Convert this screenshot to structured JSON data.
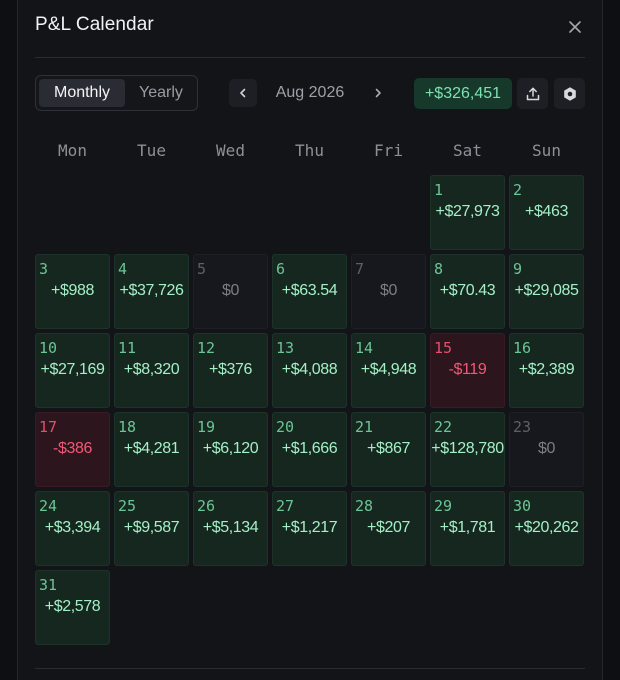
{
  "header": {
    "title": "P&L Calendar"
  },
  "toolbar": {
    "views": [
      "Monthly",
      "Yearly"
    ],
    "active_view": "Monthly",
    "month_label": "Aug 2026",
    "total": "+$326,451"
  },
  "weekdays": [
    "Mon",
    "Tue",
    "Wed",
    "Thu",
    "Fri",
    "Sat",
    "Sun"
  ],
  "calendar": {
    "first_day_column": 5,
    "days": [
      {
        "day": "1",
        "value": "+$27,973",
        "status": "pos"
      },
      {
        "day": "2",
        "value": "+$463",
        "status": "pos"
      },
      {
        "day": "3",
        "value": "+$988",
        "status": "pos"
      },
      {
        "day": "4",
        "value": "+$37,726",
        "status": "pos"
      },
      {
        "day": "5",
        "value": "$0",
        "status": "zero"
      },
      {
        "day": "6",
        "value": "+$63.54",
        "status": "pos"
      },
      {
        "day": "7",
        "value": "$0",
        "status": "zero"
      },
      {
        "day": "8",
        "value": "+$70.43",
        "status": "pos"
      },
      {
        "day": "9",
        "value": "+$29,085",
        "status": "pos"
      },
      {
        "day": "10",
        "value": "+$27,169",
        "status": "pos"
      },
      {
        "day": "11",
        "value": "+$8,320",
        "status": "pos"
      },
      {
        "day": "12",
        "value": "+$376",
        "status": "pos"
      },
      {
        "day": "13",
        "value": "+$4,088",
        "status": "pos"
      },
      {
        "day": "14",
        "value": "+$4,948",
        "status": "pos"
      },
      {
        "day": "15",
        "value": "-$119",
        "status": "neg"
      },
      {
        "day": "16",
        "value": "+$2,389",
        "status": "pos"
      },
      {
        "day": "17",
        "value": "-$386",
        "status": "neg"
      },
      {
        "day": "18",
        "value": "+$4,281",
        "status": "pos"
      },
      {
        "day": "19",
        "value": "+$6,120",
        "status": "pos"
      },
      {
        "day": "20",
        "value": "+$1,666",
        "status": "pos"
      },
      {
        "day": "21",
        "value": "+$867",
        "status": "pos"
      },
      {
        "day": "22",
        "value": "+$128,780",
        "status": "pos"
      },
      {
        "day": "23",
        "value": "$0",
        "status": "zero"
      },
      {
        "day": "24",
        "value": "+$3,394",
        "status": "pos"
      },
      {
        "day": "25",
        "value": "+$9,587",
        "status": "pos"
      },
      {
        "day": "26",
        "value": "+$5,134",
        "status": "pos"
      },
      {
        "day": "27",
        "value": "+$1,217",
        "status": "pos"
      },
      {
        "day": "28",
        "value": "+$207",
        "status": "pos"
      },
      {
        "day": "29",
        "value": "+$1,781",
        "status": "pos"
      },
      {
        "day": "30",
        "value": "+$20,262",
        "status": "pos"
      },
      {
        "day": "31",
        "value": "+$2,578",
        "status": "pos"
      }
    ]
  },
  "colors": {
    "positive": "#a4f0c6",
    "negative": "#f25878",
    "zero": "#7b7e86",
    "badge_bg": "#16392c"
  },
  "icons": {
    "close": "close-icon",
    "prev": "chevron-left-icon",
    "next": "chevron-right-icon",
    "share": "share-icon",
    "settings": "hexagon-settings-icon"
  }
}
